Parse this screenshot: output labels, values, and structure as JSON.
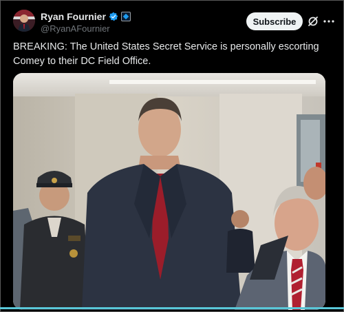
{
  "tweet": {
    "display_name": "Ryan Fournier",
    "handle": "@RyanAFournier",
    "subscribe_label": "Subscribe",
    "text": "BREAKING: The United States Secret Service is personally escorting Comey to their DC Field Office."
  },
  "icons": {
    "verified": "verified-badge-icon",
    "affiliate": "affiliate-badge-icon",
    "grok": "grok-icon",
    "more": "more-options-icon"
  },
  "colors": {
    "background": "#000000",
    "subscribe_bg": "#eff3f4",
    "verified_blue": "#1d9bf0",
    "handle_gray": "#71767b",
    "bottom_accent": "#59c7d8"
  }
}
